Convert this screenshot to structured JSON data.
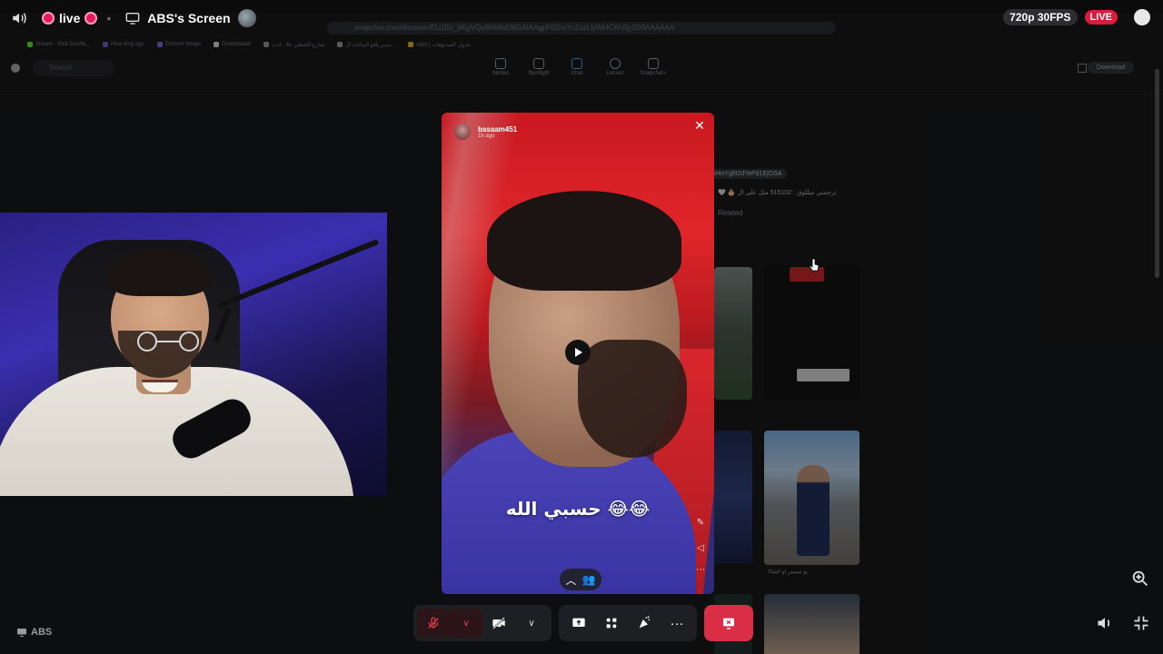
{
  "topbar": {
    "live_label": "live",
    "screen_title": "ABS's Screen",
    "quality": "720p 30FPS",
    "live_badge": "LIVE"
  },
  "browser": {
    "url": "snapchat.com/discover/EU1Ec_bKgVQu9hN6tdJ8GAtAAgpF02nvYc2uzLfyWHCKh5jy5D3AAAAAA",
    "bookmarks": [
      "Stream - Kick Dashb...",
      "How long ago",
      "Convert Image",
      "Downloader",
      "شارع الشعلي جلا - ادب",
      "مدير يلغو البيانات ال...",
      "ABS | جدول الفيديوهات"
    ],
    "search_placeholder": "Search",
    "nav": [
      "Stories",
      "Spotlight",
      "Chat",
      "Lenses",
      "Snapchat+"
    ],
    "download_label": "Download",
    "hash_chip": "#4xYgl02dYePd1EjOSA",
    "description": "🤍 🎂 ترجمتي مبللوق : 515102 مثل على ال",
    "related_label": "Related",
    "thumb_caption": "يو سيسر او الشالا"
  },
  "snap": {
    "username": "basaam451",
    "time": "1h ago",
    "caption": "حسبي الله 😂😂"
  },
  "controls": {
    "more_label": "···"
  },
  "bottom": {
    "user_label": "ABS"
  },
  "colors": {
    "live_pink": "#e6195f",
    "live_red": "#d81e3c",
    "end_call_red": "#da2e47",
    "snap_red": "#e0262a",
    "shirt_purple": "#3732a0"
  }
}
